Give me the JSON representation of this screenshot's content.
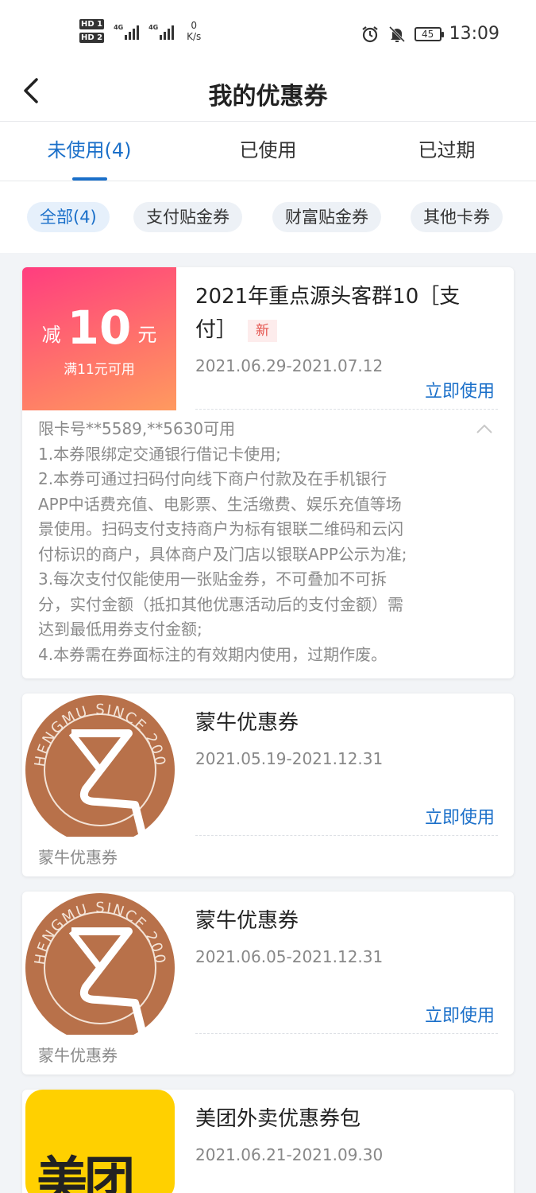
{
  "status_bar": {
    "hd1": "HD 1",
    "hd2": "HD 2",
    "net1": "4G",
    "net2": "4G",
    "speed_value": "0",
    "speed_unit": "K/s",
    "battery": "45",
    "time": "13:09",
    "icons": [
      "alarm-icon",
      "bell-muted-icon",
      "battery-icon"
    ]
  },
  "header": {
    "title": "我的优惠券",
    "back_icon": "chevron-left-icon"
  },
  "tabs": [
    {
      "label": "未使用(4)",
      "active": true
    },
    {
      "label": "已使用",
      "active": false
    },
    {
      "label": "已过期",
      "active": false
    }
  ],
  "filters": [
    {
      "label": "全部(4)",
      "active": true
    },
    {
      "label": "支付贴金券",
      "active": false
    },
    {
      "label": "财富贴金券",
      "active": false
    },
    {
      "label": "其他卡券",
      "active": false
    }
  ],
  "coupons": [
    {
      "title_line1": "2021年重点源头客群10［支",
      "title_line2": "付］",
      "tag": "新",
      "date": "2021.06.29-2021.07.12",
      "action": "立即使用",
      "badge_prefix": "减",
      "badge_amount": "10",
      "badge_unit": "元",
      "badge_condition": "满11元可用",
      "rules": [
        "限卡号**5589,**5630可用",
        "1.本券限绑定交通银行借记卡使用;",
        "2.本券可通过扫码付向线下商户付款及在手机银行",
        "APP中话费充值、电影票、生活缴费、娱乐充值等场",
        "景使用。扫码支付支持商户为标有银联二维码和云闪",
        "付标识的商户，具体商户及门店以银联APP公示为准;",
        "3.每次支付仅能使用一张贴金券，不可叠加不可拆",
        "分，实付金额（抵扣其他优惠活动后的支付金额）需",
        "达到最低用券支付金额;",
        "4.本券需在券面标注的有效期内使用，过期作废。"
      ],
      "colors": {
        "gradient_start": "#ff3d7f",
        "gradient_end": "#ff9a5f"
      }
    },
    {
      "title": "蒙牛优惠券",
      "date": "2021.05.19-2021.12.31",
      "action": "立即使用",
      "caption": "蒙牛优惠券",
      "logo_text": "SHENGMU SINCE 2009"
    },
    {
      "title": "蒙牛优惠券",
      "date": "2021.06.05-2021.12.31",
      "action": "立即使用",
      "caption": "蒙牛优惠券",
      "logo_text": "SHENGMU SINCE 2009"
    },
    {
      "title": "美团外卖优惠券包",
      "date": "2021.06.21-2021.09.30",
      "logo_text": "美团"
    }
  ],
  "colors": {
    "accent": "#1a6fc9",
    "background": "#f2f4f7",
    "tag_red": "#e4534d",
    "shengmu_copper": "#b8714a",
    "meituan_yellow": "#ffd000"
  }
}
